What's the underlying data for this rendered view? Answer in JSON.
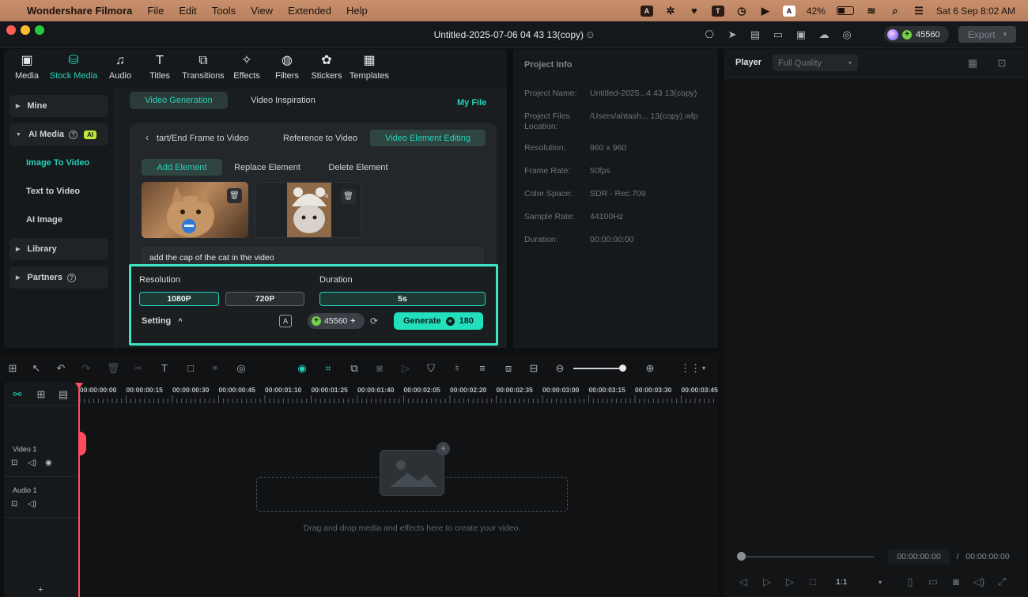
{
  "menubar": {
    "app_name": "Wondershare Filmora",
    "items": [
      "File",
      "Edit",
      "Tools",
      "View",
      "Extended",
      "Help"
    ],
    "battery": "42%",
    "datetime": "Sat 6 Sep  8:02 AM"
  },
  "window": {
    "title": "Untitled-2025-07-06 04 43 13(copy)",
    "credits": "45560",
    "export_label": "Export"
  },
  "media_tabs": [
    {
      "label": "Media",
      "icon": "media-icon"
    },
    {
      "label": "Stock Media",
      "icon": "stock-media-icon",
      "active": true
    },
    {
      "label": "Audio",
      "icon": "audio-icon"
    },
    {
      "label": "Titles",
      "icon": "titles-icon"
    },
    {
      "label": "Transitions",
      "icon": "transitions-icon"
    },
    {
      "label": "Effects",
      "icon": "effects-icon"
    },
    {
      "label": "Filters",
      "icon": "filters-icon"
    },
    {
      "label": "Stickers",
      "icon": "stickers-icon"
    },
    {
      "label": "Templates",
      "icon": "templates-icon"
    }
  ],
  "sidebar": {
    "mine": "Mine",
    "ai_media": "AI Media",
    "ai_badge": "AI",
    "sub_items": [
      "Image To Video",
      "Text to Video",
      "AI Image"
    ],
    "library": "Library",
    "partners": "Partners"
  },
  "generation": {
    "top_tabs": [
      "Video Generation",
      "Video Inspiration"
    ],
    "my_file": "My File",
    "mode_tabs": [
      "tart/End Frame to Video",
      "Reference to Video",
      "Video Element Editing"
    ],
    "element_tabs": [
      "Add Element",
      "Replace Element",
      "Delete Element"
    ],
    "prompt": "add the cap of the cat in the video",
    "resolution_label": "Resolution",
    "resolution_options": [
      "1080P",
      "720P"
    ],
    "duration_label": "Duration",
    "duration_value": "5s",
    "setting_label": "Setting",
    "credits": "45560",
    "generate_label": "Generate",
    "generate_cost": "180"
  },
  "project_info": {
    "heading": "Project Info",
    "rows": [
      {
        "key": "Project Name:",
        "value": "Untitled-2025...4 43 13(copy)"
      },
      {
        "key": "Project Files Location:",
        "value": "/Users/ahtash... 13(copy).wfp"
      },
      {
        "key": "Resolution:",
        "value": "960 x 960"
      },
      {
        "key": "Frame Rate:",
        "value": "50fps"
      },
      {
        "key": "Color Space:",
        "value": "SDR - Rec.709"
      },
      {
        "key": "Sample Rate:",
        "value": "44100Hz"
      },
      {
        "key": "Duration:",
        "value": "00:00:00:00"
      }
    ]
  },
  "player": {
    "label": "Player",
    "quality": "Full Quality",
    "current_time": "00:00:00:00",
    "separator": "/",
    "total_time": "00:00:00:00",
    "ratio": "1:1"
  },
  "timeline": {
    "ruler": [
      "00:00:00:00",
      "00:00:00:15",
      "00:00:00:30",
      "00:00:00:45",
      "00:00:01:10",
      "00:00:01:25",
      "00:00:01:40",
      "00:00:02:05",
      "00:00:02:20",
      "00:00:02:35",
      "00:00:03:00",
      "00:00:03:15",
      "00:00:03:30",
      "00:00:03:45"
    ],
    "video_track": "Video 1",
    "audio_track": "Audio 1",
    "drop_message": "Drag and drop media and effects here to create your video."
  },
  "colors": {
    "accent": "#23d3b9",
    "highlight": "#3fe4c4",
    "playhead": "#ff4d5e"
  }
}
